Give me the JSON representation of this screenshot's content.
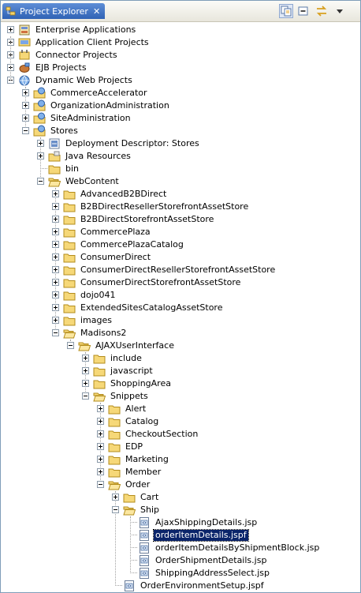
{
  "view": {
    "title": "Project Explorer",
    "close_icon": "close-icon",
    "toolbar": [
      "link-with-editor-icon",
      "collapse-all-icon",
      "sync-icon",
      "view-menu-icon"
    ]
  },
  "tree": [
    {
      "d": 0,
      "t": "Enterprise Applications",
      "i": "ear",
      "s": "plus"
    },
    {
      "d": 0,
      "t": "Application Client Projects",
      "i": "client",
      "s": "plus"
    },
    {
      "d": 0,
      "t": "Connector Projects",
      "i": "connector",
      "s": "plus"
    },
    {
      "d": 0,
      "t": "EJB Projects",
      "i": "ejb",
      "s": "plus"
    },
    {
      "d": 0,
      "t": "Dynamic Web Projects",
      "i": "web",
      "s": "minus"
    },
    {
      "d": 1,
      "t": "CommerceAccelerator",
      "i": "webproj",
      "s": "plus"
    },
    {
      "d": 1,
      "t": "OrganizationAdministration",
      "i": "webproj",
      "s": "plus"
    },
    {
      "d": 1,
      "t": "SiteAdministration",
      "i": "webproj",
      "s": "plus"
    },
    {
      "d": 1,
      "t": "Stores",
      "i": "webproj",
      "s": "minus"
    },
    {
      "d": 2,
      "t": "Deployment Descriptor: Stores",
      "i": "dd",
      "s": "plus"
    },
    {
      "d": 2,
      "t": "Java Resources",
      "i": "javares",
      "s": "plus"
    },
    {
      "d": 2,
      "t": "bin",
      "i": "folder",
      "s": "none"
    },
    {
      "d": 2,
      "t": "WebContent",
      "i": "folderopen",
      "s": "minus"
    },
    {
      "d": 3,
      "t": "AdvancedB2BDirect",
      "i": "folder",
      "s": "plus"
    },
    {
      "d": 3,
      "t": "B2BDirectResellerStorefrontAssetStore",
      "i": "folder",
      "s": "plus"
    },
    {
      "d": 3,
      "t": "B2BDirectStorefrontAssetStore",
      "i": "folder",
      "s": "plus"
    },
    {
      "d": 3,
      "t": "CommercePlaza",
      "i": "folder",
      "s": "plus"
    },
    {
      "d": 3,
      "t": "CommercePlazaCatalog",
      "i": "folder",
      "s": "plus"
    },
    {
      "d": 3,
      "t": "ConsumerDirect",
      "i": "folder",
      "s": "plus"
    },
    {
      "d": 3,
      "t": "ConsumerDirectResellerStorefrontAssetStore",
      "i": "folder",
      "s": "plus"
    },
    {
      "d": 3,
      "t": "ConsumerDirectStorefrontAssetStore",
      "i": "folder",
      "s": "plus"
    },
    {
      "d": 3,
      "t": "dojo041",
      "i": "folder",
      "s": "plus"
    },
    {
      "d": 3,
      "t": "ExtendedSitesCatalogAssetStore",
      "i": "folder",
      "s": "plus"
    },
    {
      "d": 3,
      "t": "images",
      "i": "folder",
      "s": "plus"
    },
    {
      "d": 3,
      "t": "Madisons2",
      "i": "folderopen",
      "s": "minus"
    },
    {
      "d": 4,
      "t": "AJAXUserInterface",
      "i": "folderopen",
      "s": "minus"
    },
    {
      "d": 5,
      "t": "include",
      "i": "folder",
      "s": "plus"
    },
    {
      "d": 5,
      "t": "javascript",
      "i": "folder",
      "s": "plus"
    },
    {
      "d": 5,
      "t": "ShoppingArea",
      "i": "folder",
      "s": "plus"
    },
    {
      "d": 5,
      "t": "Snippets",
      "i": "folderopen",
      "s": "minus"
    },
    {
      "d": 6,
      "t": "Alert",
      "i": "folder",
      "s": "plus"
    },
    {
      "d": 6,
      "t": "Catalog",
      "i": "folder",
      "s": "plus"
    },
    {
      "d": 6,
      "t": "CheckoutSection",
      "i": "folder",
      "s": "plus"
    },
    {
      "d": 6,
      "t": "EDP",
      "i": "folder",
      "s": "plus"
    },
    {
      "d": 6,
      "t": "Marketing",
      "i": "folder",
      "s": "plus"
    },
    {
      "d": 6,
      "t": "Member",
      "i": "folder",
      "s": "plus"
    },
    {
      "d": 6,
      "t": "Order",
      "i": "folderopen",
      "s": "minus"
    },
    {
      "d": 7,
      "t": "Cart",
      "i": "folder",
      "s": "plus"
    },
    {
      "d": 7,
      "t": "Ship",
      "i": "folderopen",
      "s": "minus"
    },
    {
      "d": 8,
      "t": "AjaxShippingDetails.jsp",
      "i": "jsp",
      "s": "none"
    },
    {
      "d": 8,
      "t": "orderItemDetails.jspf",
      "i": "jsp",
      "s": "none",
      "sel": true
    },
    {
      "d": 8,
      "t": "orderItemDetailsByShipmentBlock.jsp",
      "i": "jsp",
      "s": "none"
    },
    {
      "d": 8,
      "t": "OrderShipmentDetails.jsp",
      "i": "jsp",
      "s": "none"
    },
    {
      "d": 8,
      "t": "ShippingAddressSelect.jsp",
      "i": "jsp",
      "s": "none"
    },
    {
      "d": 7,
      "t": "OrderEnvironmentSetup.jspf",
      "i": "jsp",
      "s": "none"
    }
  ]
}
